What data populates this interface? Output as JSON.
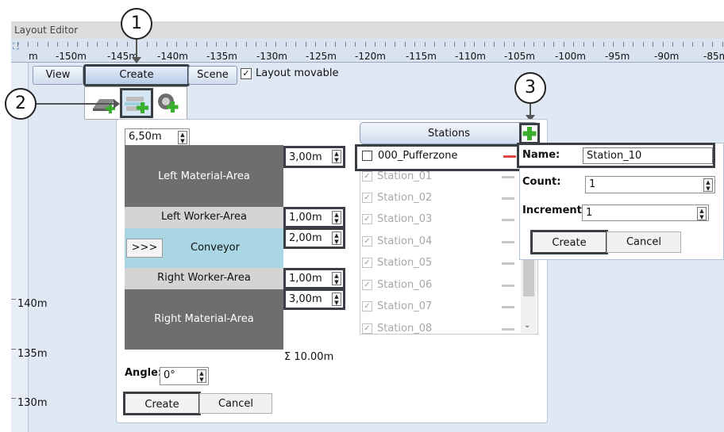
{
  "window": {
    "title": "Layout Editor"
  },
  "ruler": {
    "labels": [
      "m",
      "-150m",
      "-145m",
      "-140m",
      "-135m",
      "-130m",
      "-125m",
      "-120m",
      "-115m",
      "-110m",
      "-105m",
      "-100m",
      "-95m",
      "-90m",
      "-85m"
    ],
    "vertical_labels": [
      "140m",
      "135m",
      "130m"
    ]
  },
  "toolbar": {
    "view_label": "View",
    "create_label": "Create",
    "scene_label": "Scene",
    "layout_movable_label": "Layout movable",
    "layout_movable_checked": true
  },
  "icons": [
    "add-floor-icon",
    "add-station-icon",
    "add-robot-icon"
  ],
  "callouts": [
    "1",
    "2",
    "3"
  ],
  "section_panel": {
    "total_width": "6,50m",
    "areas": [
      {
        "label": "Left Material-Area",
        "value": "3,00m"
      },
      {
        "label": "Left Worker-Area",
        "value": "1,00m"
      },
      {
        "label": "Conveyor",
        "value": "2,00m",
        "button": ">>>"
      },
      {
        "label": "Right Worker-Area",
        "value": "1,00m"
      },
      {
        "label": "Right Material-Area",
        "value": "3,00m"
      }
    ],
    "sum_label": "Σ  10.00m",
    "angle_label": "Angle:",
    "angle_value": "0°",
    "create_label": "Create",
    "cancel_label": "Cancel"
  },
  "stations": {
    "header": "Stations",
    "items": [
      {
        "name": "000_Pufferzone",
        "checked": false
      },
      {
        "name": "Station_01",
        "checked": true
      },
      {
        "name": "Station_02",
        "checked": true
      },
      {
        "name": "Station_03",
        "checked": true
      },
      {
        "name": "Station_04",
        "checked": true
      },
      {
        "name": "Station_05",
        "checked": true
      },
      {
        "name": "Station_06",
        "checked": true
      },
      {
        "name": "Station_07",
        "checked": true
      },
      {
        "name": "Station_08",
        "checked": true
      }
    ]
  },
  "new_station": {
    "name_label": "Name:",
    "name_value": "Station_10",
    "count_label": "Count:",
    "count_value": "1",
    "increment_label": "Increment:",
    "increment_value": "1",
    "create_label": "Create",
    "cancel_label": "Cancel"
  },
  "colors": {
    "material_area": "#6e6e6e",
    "worker_area": "#d4d4d4",
    "conveyor": "#a9d6e2",
    "remove_active": "#e0473c",
    "add_green": "#3cae2e"
  }
}
